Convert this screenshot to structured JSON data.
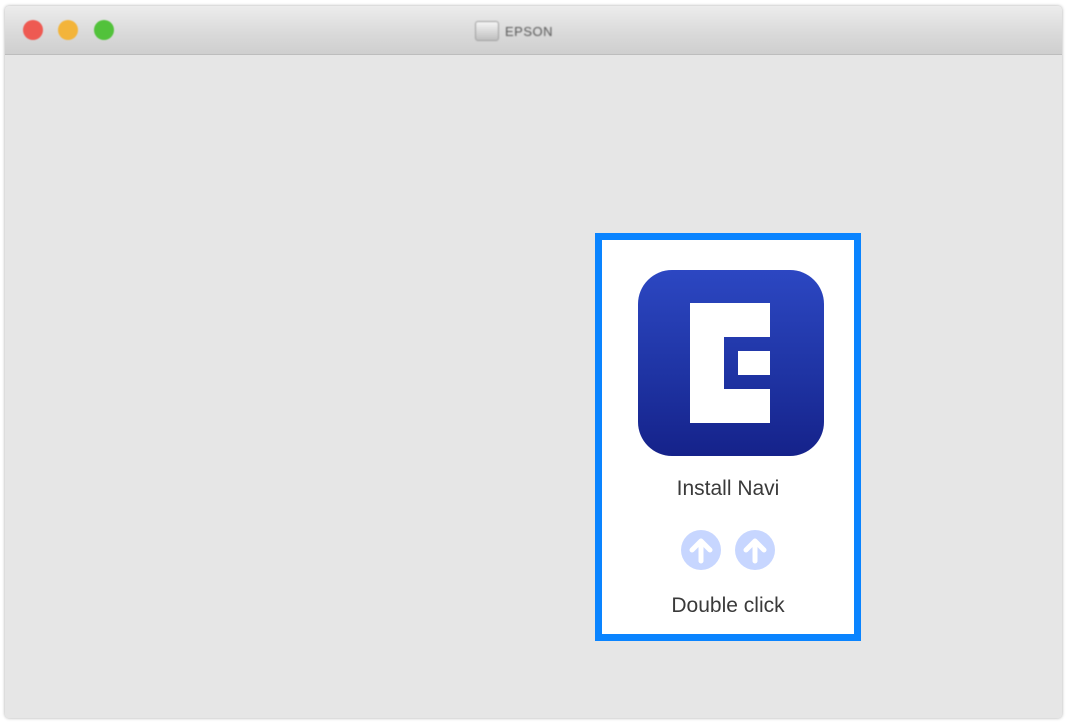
{
  "window": {
    "title": "EPSON",
    "traffic_lights": {
      "close": "#ee5a52",
      "minimize": "#f3b43a",
      "zoom": "#52c23b"
    }
  },
  "installer": {
    "app_icon": "epson-e-logo-icon",
    "install_label": "Install Navi",
    "arrow_icon": "up-arrow-circle-icon",
    "instruction": "Double click",
    "highlight_color": "#0a84ff"
  }
}
